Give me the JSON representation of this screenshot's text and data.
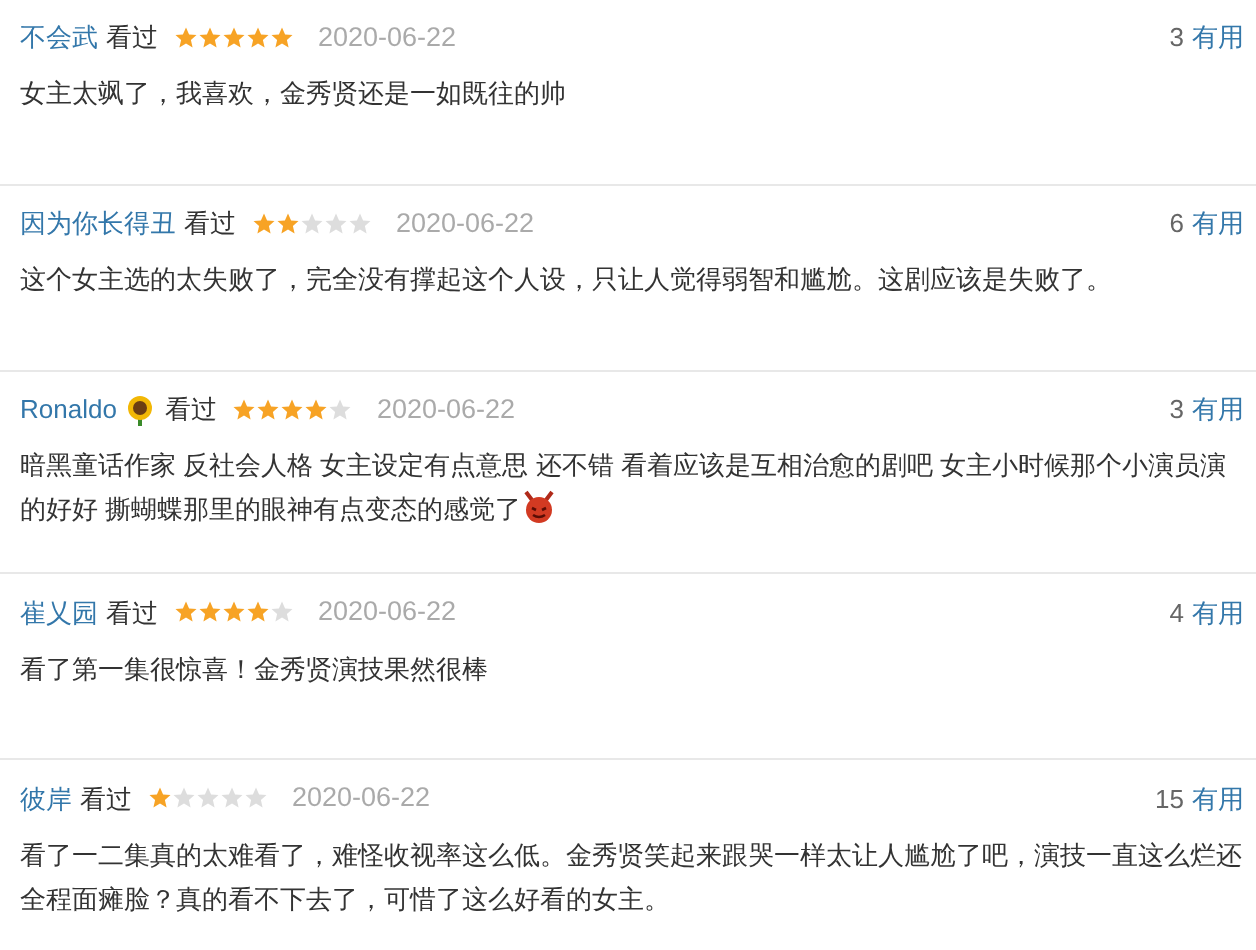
{
  "reviews": [
    {
      "user": "不会武",
      "status": "看过",
      "stars": 5,
      "date": "2020-06-22",
      "votes": "3",
      "vote_label": "有用",
      "text": "女主太飒了，我喜欢，金秀贤还是一如既往的帅"
    },
    {
      "user": "因为你长得丑",
      "status": "看过",
      "stars": 2,
      "date": "2020-06-22",
      "votes": "6",
      "vote_label": "有用",
      "text": "这个女主选的太失败了，完全没有撑起这个人设，只让人觉得弱智和尴尬。这剧应该是失败了。"
    },
    {
      "user": "Ronaldo",
      "user_badge": {
        "kind": "sunflower"
      },
      "status": "看过",
      "stars": 4,
      "date": "2020-06-22",
      "votes": "3",
      "vote_label": "有用",
      "text": "暗黑童话作家 反社会人格 女主设定有点意思 还不错 看着应该是互相治愈的剧吧 女主小时候那个小演员演的好好 撕蝴蝶那里的眼神有点变态的感觉了",
      "text_end": {
        "kind": "devil"
      }
    },
    {
      "user": "崔乂园",
      "status": "看过",
      "stars": 4,
      "date": "2020-06-22",
      "votes": "4",
      "vote_label": "有用",
      "text": "看了第一集很惊喜！金秀贤演技果然很棒"
    },
    {
      "user": "彼岸",
      "status": "看过",
      "stars": 1,
      "date": "2020-06-22",
      "votes": "15",
      "vote_label": "有用",
      "text": "看了一二集真的太难看了，难怪收视率这么低。金秀贤笑起来跟哭一样太让人尴尬了吧，演技一直这么烂还全程面瘫脸？真的看不下去了，可惜了这么好看的女主。"
    }
  ]
}
